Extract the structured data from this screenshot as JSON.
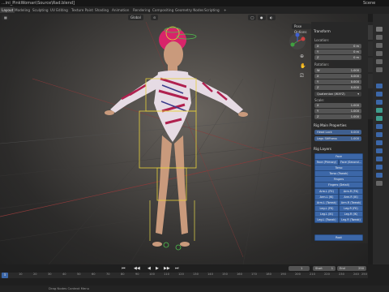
{
  "title_bar": {
    "file_path": "...ini_PinkWoman\\Source\\Rad.blend]",
    "scene_label": "Scene"
  },
  "workspace_tabs": [
    "Layout",
    "Modeling",
    "Sculpting",
    "UV Editing",
    "Texture Paint",
    "Shading",
    "Animation",
    "Rendering",
    "Compositing",
    "Geometry Nodes",
    "Scripting",
    "+"
  ],
  "viewport_header": {
    "mode": "Global",
    "pose_options": "Pose Options"
  },
  "npanel": {
    "transform_title": "Transform",
    "location_label": "Location:",
    "location": [
      {
        "axis": "X",
        "value": "0 m"
      },
      {
        "axis": "Y",
        "value": "0 m"
      },
      {
        "axis": "Z",
        "value": "0 m"
      }
    ],
    "rotation_label": "Rotation:",
    "rotation": [
      {
        "axis": "W",
        "value": "1.000"
      },
      {
        "axis": "X",
        "value": "0.000"
      },
      {
        "axis": "Y",
        "value": "0.000"
      },
      {
        "axis": "Z",
        "value": "0.000"
      }
    ],
    "rotation_mode": "Quaternion (WXYZ)",
    "scale_label": "Scale:",
    "scale": [
      {
        "axis": "X",
        "value": "1.000"
      },
      {
        "axis": "Y",
        "value": "1.000"
      },
      {
        "axis": "Z",
        "value": "1.000"
      }
    ],
    "rig_props_title": "Rig Main Properties",
    "rig_props": [
      {
        "label": "Head Lock",
        "value": "0.000"
      },
      {
        "label": "Legs Stiffness",
        "value": "1.000"
      }
    ],
    "rig_layers_title": "Rig Layers",
    "rig_layers_full": [
      "Face",
      "Torso",
      "Torso (Tweak)",
      "Fingers",
      "Fingers (Detail)"
    ],
    "face_pair": [
      "Face (Primary)",
      "Face (Second..."
    ],
    "rig_layers_pairs": [
      [
        "Arm.L (FK)",
        "Arm.R (FK)"
      ],
      [
        "Arm.L (IK)",
        "Arm.R (IK)"
      ],
      [
        "Arm.L (Tweak)",
        "Arm.R (Tweak)"
      ],
      [
        "Leg.L (FK)",
        "Leg.R (FK)"
      ],
      [
        "Leg.L (IK)",
        "Leg.R (IK)"
      ],
      [
        "Leg.L (Tweak)",
        "Leg.R (Tweak)"
      ]
    ],
    "root_label": "Root"
  },
  "timeline": {
    "current_frame": "1",
    "start_label": "Start",
    "start_value": "1",
    "end_label": "End",
    "end_value": "250",
    "ruler_ticks": [
      "0",
      "10",
      "20",
      "30",
      "40",
      "50",
      "60",
      "70",
      "80",
      "90",
      "100",
      "110",
      "120",
      "130",
      "140",
      "150",
      "160",
      "170",
      "180",
      "190",
      "200",
      "210",
      "220",
      "230",
      "240",
      "250"
    ]
  },
  "status_bar": {
    "hint": "Drag Nodes Context Menu"
  },
  "colors": {
    "accent_blue": "#3c67a8",
    "panel_bg": "#282828",
    "field_bg": "#545454"
  }
}
